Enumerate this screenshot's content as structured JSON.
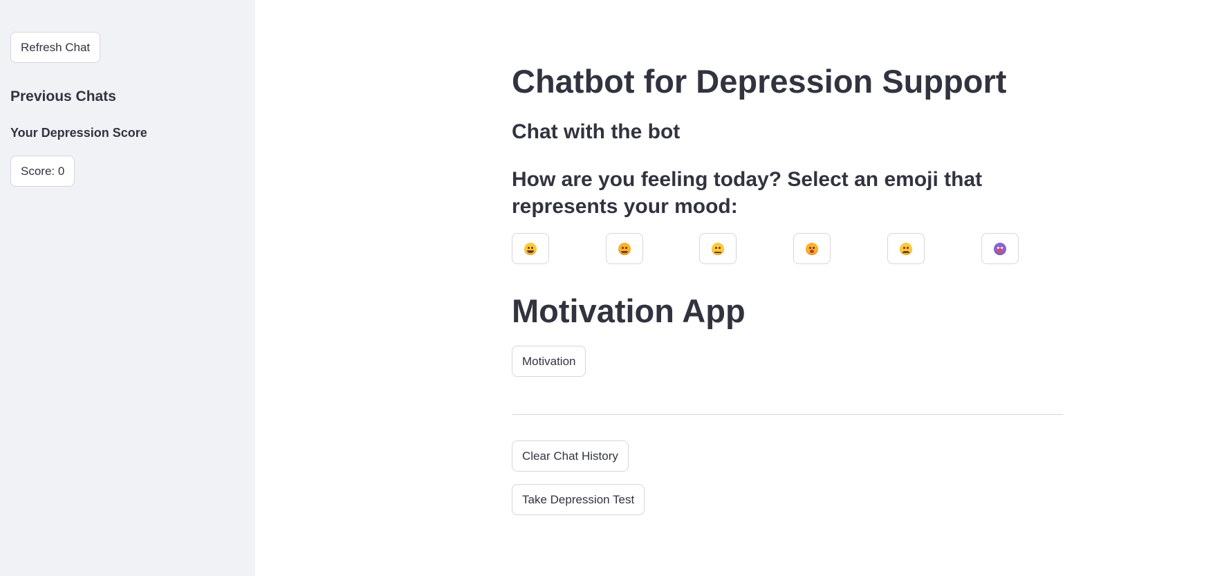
{
  "sidebar": {
    "refresh_label": "Refresh Chat",
    "previous_chats_heading": "Previous Chats",
    "score_heading": "Your Depression Score",
    "score_label": "Score: 0"
  },
  "main": {
    "title": "Chatbot for Depression Support",
    "chat_subheading": "Chat with the bot",
    "mood_prompt": "How are you feeling today? Select an emoji that represents your mood:",
    "emojis": [
      {
        "icon": "grinning-face-icon",
        "color": "#ffc83d"
      },
      {
        "icon": "smiling-face-icon",
        "color": "#ffb02e"
      },
      {
        "icon": "neutral-face-icon",
        "color": "#ffc83d"
      },
      {
        "icon": "worried-face-icon",
        "color": "#ffb02e"
      },
      {
        "icon": "sad-face-icon",
        "color": "#ffc83d"
      },
      {
        "icon": "screaming-face-icon",
        "color": "#8a63d2"
      }
    ],
    "motivation_heading": "Motivation App",
    "motivation_label": "Motivation",
    "clear_label": "Clear Chat History",
    "test_label": "Take Depression Test"
  }
}
